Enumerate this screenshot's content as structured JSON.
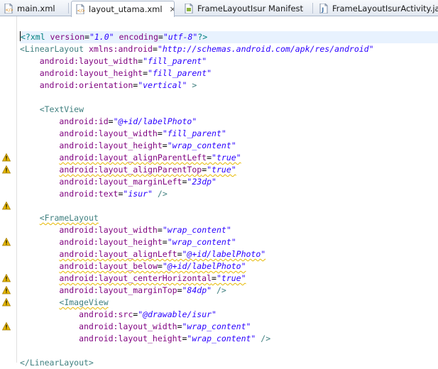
{
  "tabs": [
    {
      "label": "main.xml",
      "icon": "xml-file-icon",
      "active": false
    },
    {
      "label": "layout_utama.xml",
      "icon": "xml-file-icon",
      "active": true,
      "close": "✕"
    },
    {
      "label": "FrameLayoutIsur Manifest",
      "icon": "manifest-icon",
      "active": false
    },
    {
      "label": "FrameLayoutIsurActivity.java",
      "icon": "java-file-icon",
      "active": false
    }
  ],
  "editor": {
    "current_line": 0,
    "warning_lines": [
      10,
      11,
      14,
      17,
      20,
      21,
      22,
      24
    ],
    "lines": [
      [
        [
          "pi",
          "<?xml "
        ],
        [
          "attr",
          "version"
        ],
        [
          "eq",
          "="
        ],
        [
          "val",
          "\"1.0\""
        ],
        [
          "attr",
          " encoding"
        ],
        [
          "eq",
          "="
        ],
        [
          "val",
          "\"utf-8\""
        ],
        [
          "pi",
          "?>"
        ]
      ],
      [
        [
          "tag",
          "<LinearLayout "
        ],
        [
          "attr",
          "xmlns:android"
        ],
        [
          "eq",
          "="
        ],
        [
          "val",
          "\"http://schemas.android.com/apk/res/android\""
        ]
      ],
      [
        [
          "attr",
          "    android:layout_width"
        ],
        [
          "eq",
          "="
        ],
        [
          "val",
          "\"fill_parent\""
        ]
      ],
      [
        [
          "attr",
          "    android:layout_height"
        ],
        [
          "eq",
          "="
        ],
        [
          "val",
          "\"fill_parent\""
        ]
      ],
      [
        [
          "attr",
          "    android:orientation"
        ],
        [
          "eq",
          "="
        ],
        [
          "val",
          "\"vertical\""
        ],
        [
          "tag",
          " >"
        ]
      ],
      [],
      [
        [
          "tag",
          "    <TextView"
        ]
      ],
      [
        [
          "attr",
          "        android:id"
        ],
        [
          "eq",
          "="
        ],
        [
          "val",
          "\"@+id/labelPhoto\""
        ]
      ],
      [
        [
          "attr",
          "        android:layout_width"
        ],
        [
          "eq",
          "="
        ],
        [
          "val",
          "\"fill_parent\""
        ]
      ],
      [
        [
          "attr",
          "        android:layout_height"
        ],
        [
          "eq",
          "="
        ],
        [
          "val",
          "\"wrap_content\""
        ]
      ],
      [
        [
          "ws",
          "        "
        ],
        [
          "attrw",
          "android:layout_alignParentLeft"
        ],
        [
          "eqw",
          "="
        ],
        [
          "valw",
          "\"true\""
        ]
      ],
      [
        [
          "ws",
          "        "
        ],
        [
          "attrw",
          "android:layout_alignParentTop"
        ],
        [
          "eqw",
          "="
        ],
        [
          "valw",
          "\"true\""
        ]
      ],
      [
        [
          "attr",
          "        android:layout_marginLeft"
        ],
        [
          "eq",
          "="
        ],
        [
          "val",
          "\"23dp\""
        ]
      ],
      [
        [
          "attr",
          "        android:text"
        ],
        [
          "eq",
          "="
        ],
        [
          "val",
          "\"isur\""
        ],
        [
          "tag",
          " />"
        ]
      ],
      [],
      [
        [
          "ws",
          "    "
        ],
        [
          "tagw",
          "<FrameLayout"
        ]
      ],
      [
        [
          "attr",
          "        android:layout_width"
        ],
        [
          "eq",
          "="
        ],
        [
          "val",
          "\"wrap_content\""
        ]
      ],
      [
        [
          "attr",
          "        android:layout_height"
        ],
        [
          "eq",
          "="
        ],
        [
          "val",
          "\"wrap_content\""
        ]
      ],
      [
        [
          "ws",
          "        "
        ],
        [
          "attrw",
          "android:layout_alignLeft"
        ],
        [
          "eqw",
          "="
        ],
        [
          "valw",
          "\"@+id/labelPhoto\""
        ]
      ],
      [
        [
          "ws",
          "        "
        ],
        [
          "attrw",
          "android:layout_below"
        ],
        [
          "eqw",
          "="
        ],
        [
          "valw",
          "\"@+id/labelPhoto\""
        ]
      ],
      [
        [
          "ws",
          "        "
        ],
        [
          "attrw",
          "android:layout_centerHorizontal"
        ],
        [
          "eqw",
          "="
        ],
        [
          "valw",
          "\"true\""
        ]
      ],
      [
        [
          "attr",
          "        android:layout_marginTop"
        ],
        [
          "eq",
          "="
        ],
        [
          "val",
          "\"84dp\""
        ],
        [
          "tag",
          " />"
        ]
      ],
      [
        [
          "ws",
          "        "
        ],
        [
          "tagw",
          "<ImageView"
        ]
      ],
      [
        [
          "attr",
          "            android:src"
        ],
        [
          "eq",
          "="
        ],
        [
          "val",
          "\"@drawable/isur\""
        ]
      ],
      [
        [
          "attr",
          "            android:layout_width"
        ],
        [
          "eq",
          "="
        ],
        [
          "val",
          "\"wrap_content\""
        ]
      ],
      [
        [
          "attr",
          "            android:layout_height"
        ],
        [
          "eq",
          "="
        ],
        [
          "val",
          "\"wrap_content\""
        ],
        [
          "tag",
          " />"
        ]
      ],
      [],
      [
        [
          "tag",
          "</LinearLayout>"
        ]
      ]
    ]
  },
  "colors": {
    "tag": "#3f7f7f",
    "attribute": "#7f007f",
    "value": "#2a00ff",
    "warning": "#e6b800"
  }
}
